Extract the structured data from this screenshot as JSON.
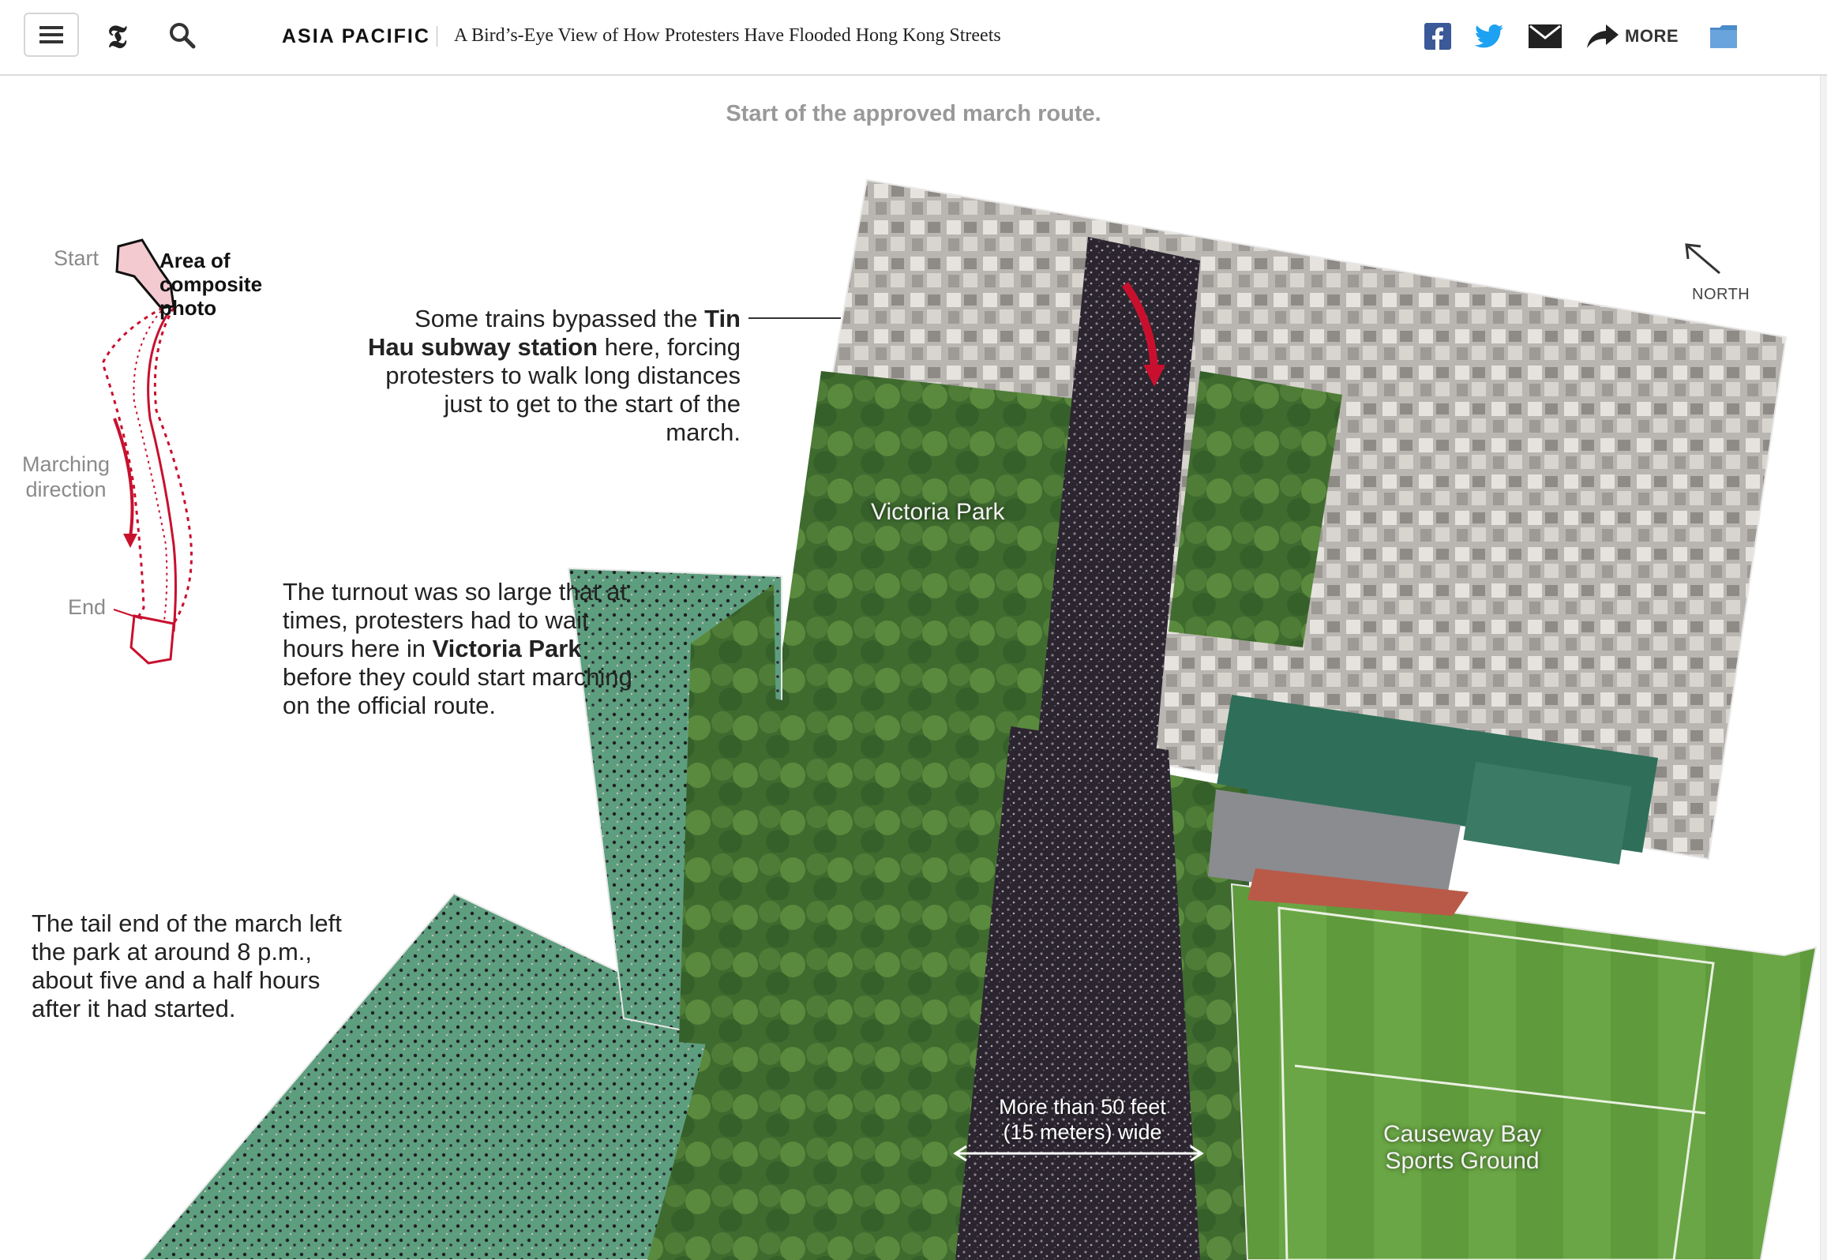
{
  "header": {
    "section": "ASIA PACIFIC",
    "headline": "A Bird’s-Eye View of How Protesters Have Flooded Hong Kong Streets",
    "more_label": "MORE",
    "icons": [
      "menu-icon",
      "nyt-logo-icon",
      "search-icon",
      "facebook-icon",
      "twitter-icon",
      "email-icon",
      "share-arrow-icon",
      "save-icon"
    ],
    "colors": {
      "facebook": "#3b5998",
      "twitter": "#1da1f2"
    }
  },
  "graphic": {
    "caption": "Start of the approved march route.",
    "annotations": {
      "tin_hau": {
        "part1": "Some trains bypassed the ",
        "bold": "Tin Hau subway station",
        "part2": " here, forcing protesters to walk long distances just to get to the start of the march."
      },
      "victoria": {
        "part1": "The turnout was so large that at times, protesters had to wait hours here in ",
        "bold": "Victoria Park",
        "part2": " before they could start marching on the official route."
      },
      "tail": "The tail end of the march left the park at around 8 p.m., about five and a half hours after it had started."
    },
    "photo_labels": {
      "victoria_park": "Victoria Park",
      "causeway_line1": "Causeway Bay",
      "causeway_line2": "Sports Ground",
      "width_line1": "More than 50 feet",
      "width_line2": "(15 meters) wide"
    },
    "north_label": "NORTH",
    "mini_map": {
      "start": "Start",
      "end": "End",
      "marching_line1": "Marching",
      "marching_line2": "direction",
      "area_line1": "Area of",
      "area_line2": "composite",
      "area_line3": "photo",
      "route_color": "#c8102e"
    }
  }
}
